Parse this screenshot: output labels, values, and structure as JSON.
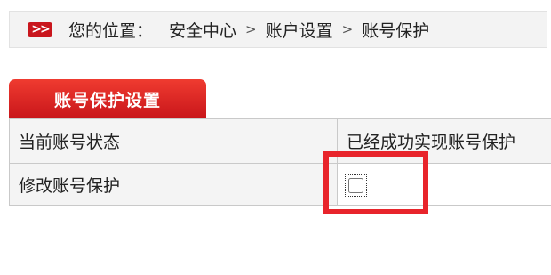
{
  "breadcrumb": {
    "icon": "double-chevron-right-icon",
    "prefix": "您的位置：",
    "separator": ">",
    "items": [
      "安全中心",
      "账户设置",
      "账号保护"
    ]
  },
  "tab": {
    "label": "账号保护设置"
  },
  "table": {
    "rows": [
      {
        "label": "当前账号状态",
        "value": "已经成功实现账号保护"
      },
      {
        "label": "修改账号保护",
        "checkbox_checked": false
      }
    ]
  },
  "colors": {
    "accent_red": "#d41f24",
    "highlight_red": "#e8242b",
    "row_background": "#f4f4f4"
  }
}
